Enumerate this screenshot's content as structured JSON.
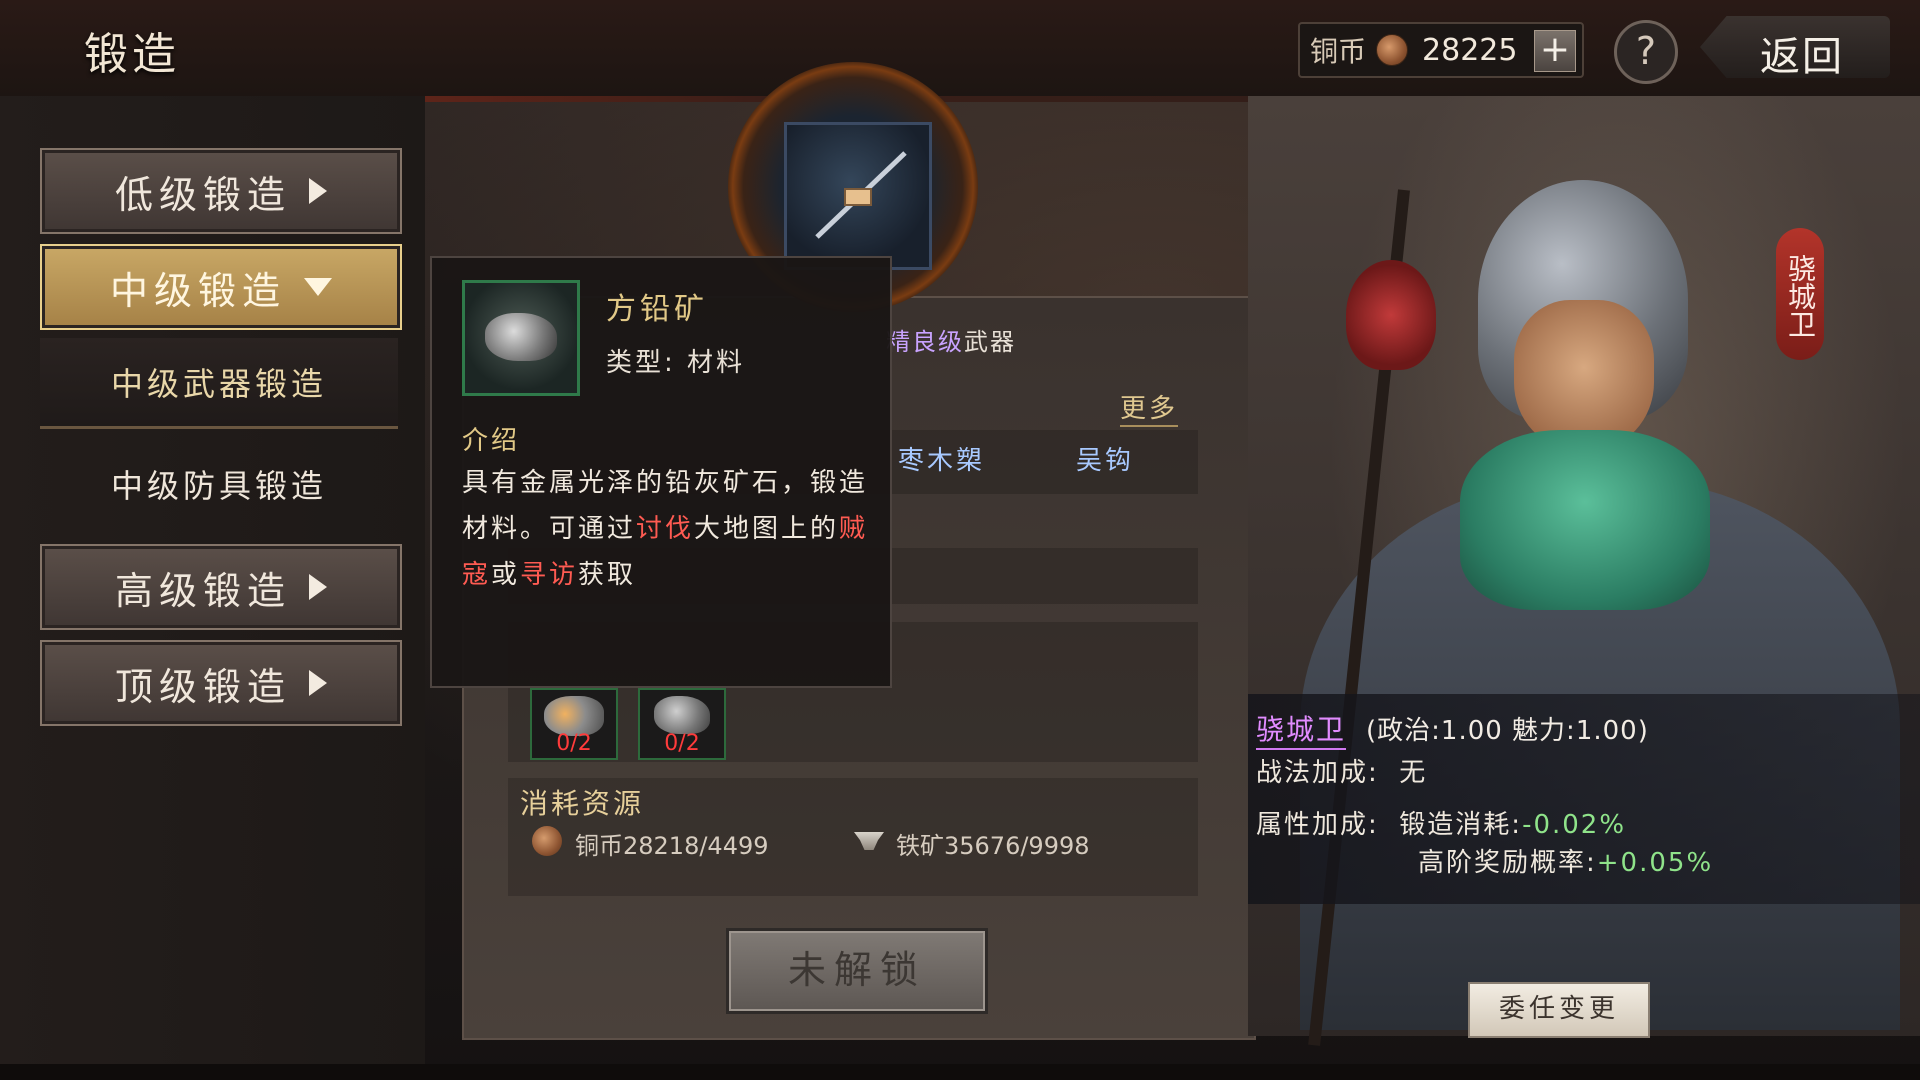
{
  "header": {
    "title": "锻造",
    "currency_label": "铜币",
    "currency_value": "28225",
    "plus_glyph": "+",
    "help_glyph": "?",
    "back_label": "返回"
  },
  "sidebar": {
    "buttons": [
      {
        "label": "低级锻造"
      },
      {
        "label": "中级锻造"
      },
      {
        "label": "高级锻造"
      },
      {
        "label": "顶级锻造"
      }
    ],
    "sub_items": [
      {
        "label": "中级武器锻造"
      },
      {
        "label": "中级防具锻造"
      }
    ]
  },
  "center": {
    "task_hint": "精良级",
    "task_suffix": "武器",
    "more_label": "更多",
    "candidates": [
      "枣木槊",
      "吴钩"
    ],
    "materials": [
      {
        "count": "0/2",
        "icon": "ore-icon"
      },
      {
        "count": "0/2",
        "icon": "lead-ore-icon"
      }
    ],
    "resources_title": "消耗资源",
    "resource_coin": "铜币28218/4499",
    "resource_iron": "铁矿35676/9998",
    "locked_label": "未解锁"
  },
  "tooltip": {
    "name": "方铅矿",
    "type": "类型: 材料",
    "intro_label": "介绍",
    "desc_1": "具有金属光泽的铅灰矿石，锻造材料。可通过",
    "desc_red_1": "讨伐",
    "desc_2": "大地图上的",
    "desc_red_2": "贼寇",
    "desc_3": "或",
    "desc_red_3": "寻访",
    "desc_4": "获取"
  },
  "character": {
    "tag_vertical": "骁城卫",
    "name": "骁城卫",
    "attrs": "(政治:1.00 魅力:1.00)",
    "tactic_label": "战法加成:",
    "tactic_value": "无",
    "attr_label": "属性加成:",
    "attr_1_label": "锻造消耗:",
    "attr_1_value": "-0.02%",
    "attr_2_label": "高阶奖励概率:",
    "attr_2_value": "+0.05%",
    "change_label": "委任变更"
  },
  "colors": {
    "accent_gold": "#c9a866",
    "highlight_red": "#ff5b52",
    "bonus_green": "#8fe38a",
    "name_purple": "#e18bff"
  }
}
